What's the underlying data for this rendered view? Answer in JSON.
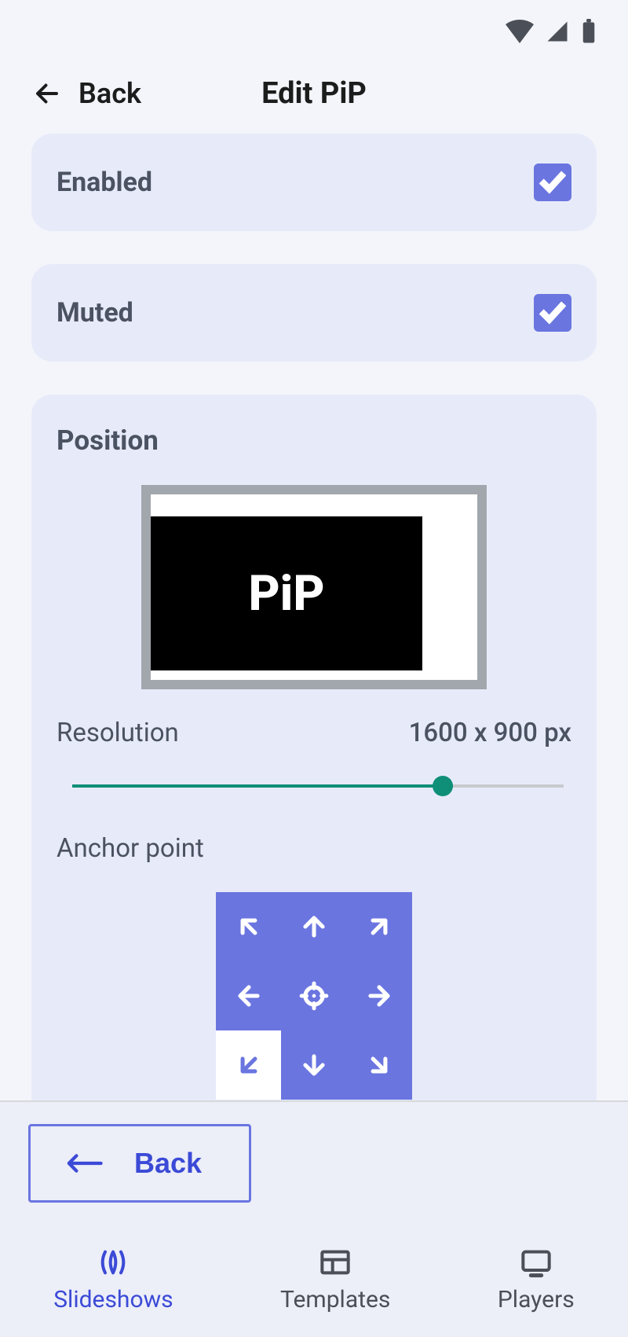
{
  "header": {
    "back_label": "Back",
    "title": "Edit PiP"
  },
  "card_enabled": {
    "label": "Enabled",
    "checked": true
  },
  "card_muted": {
    "label": "Muted",
    "checked": true
  },
  "position": {
    "title": "Position",
    "pip_label": "PiP",
    "resolution_label": "Resolution",
    "resolution_value": "1600 x 900 px",
    "anchor_label": "Anchor point",
    "anchor_selected": "bottom-left"
  },
  "bottom_button": {
    "label": "Back"
  },
  "tabs": {
    "slideshows": "Slideshows",
    "templates": "Templates",
    "players": "Players",
    "active": "slideshows"
  }
}
